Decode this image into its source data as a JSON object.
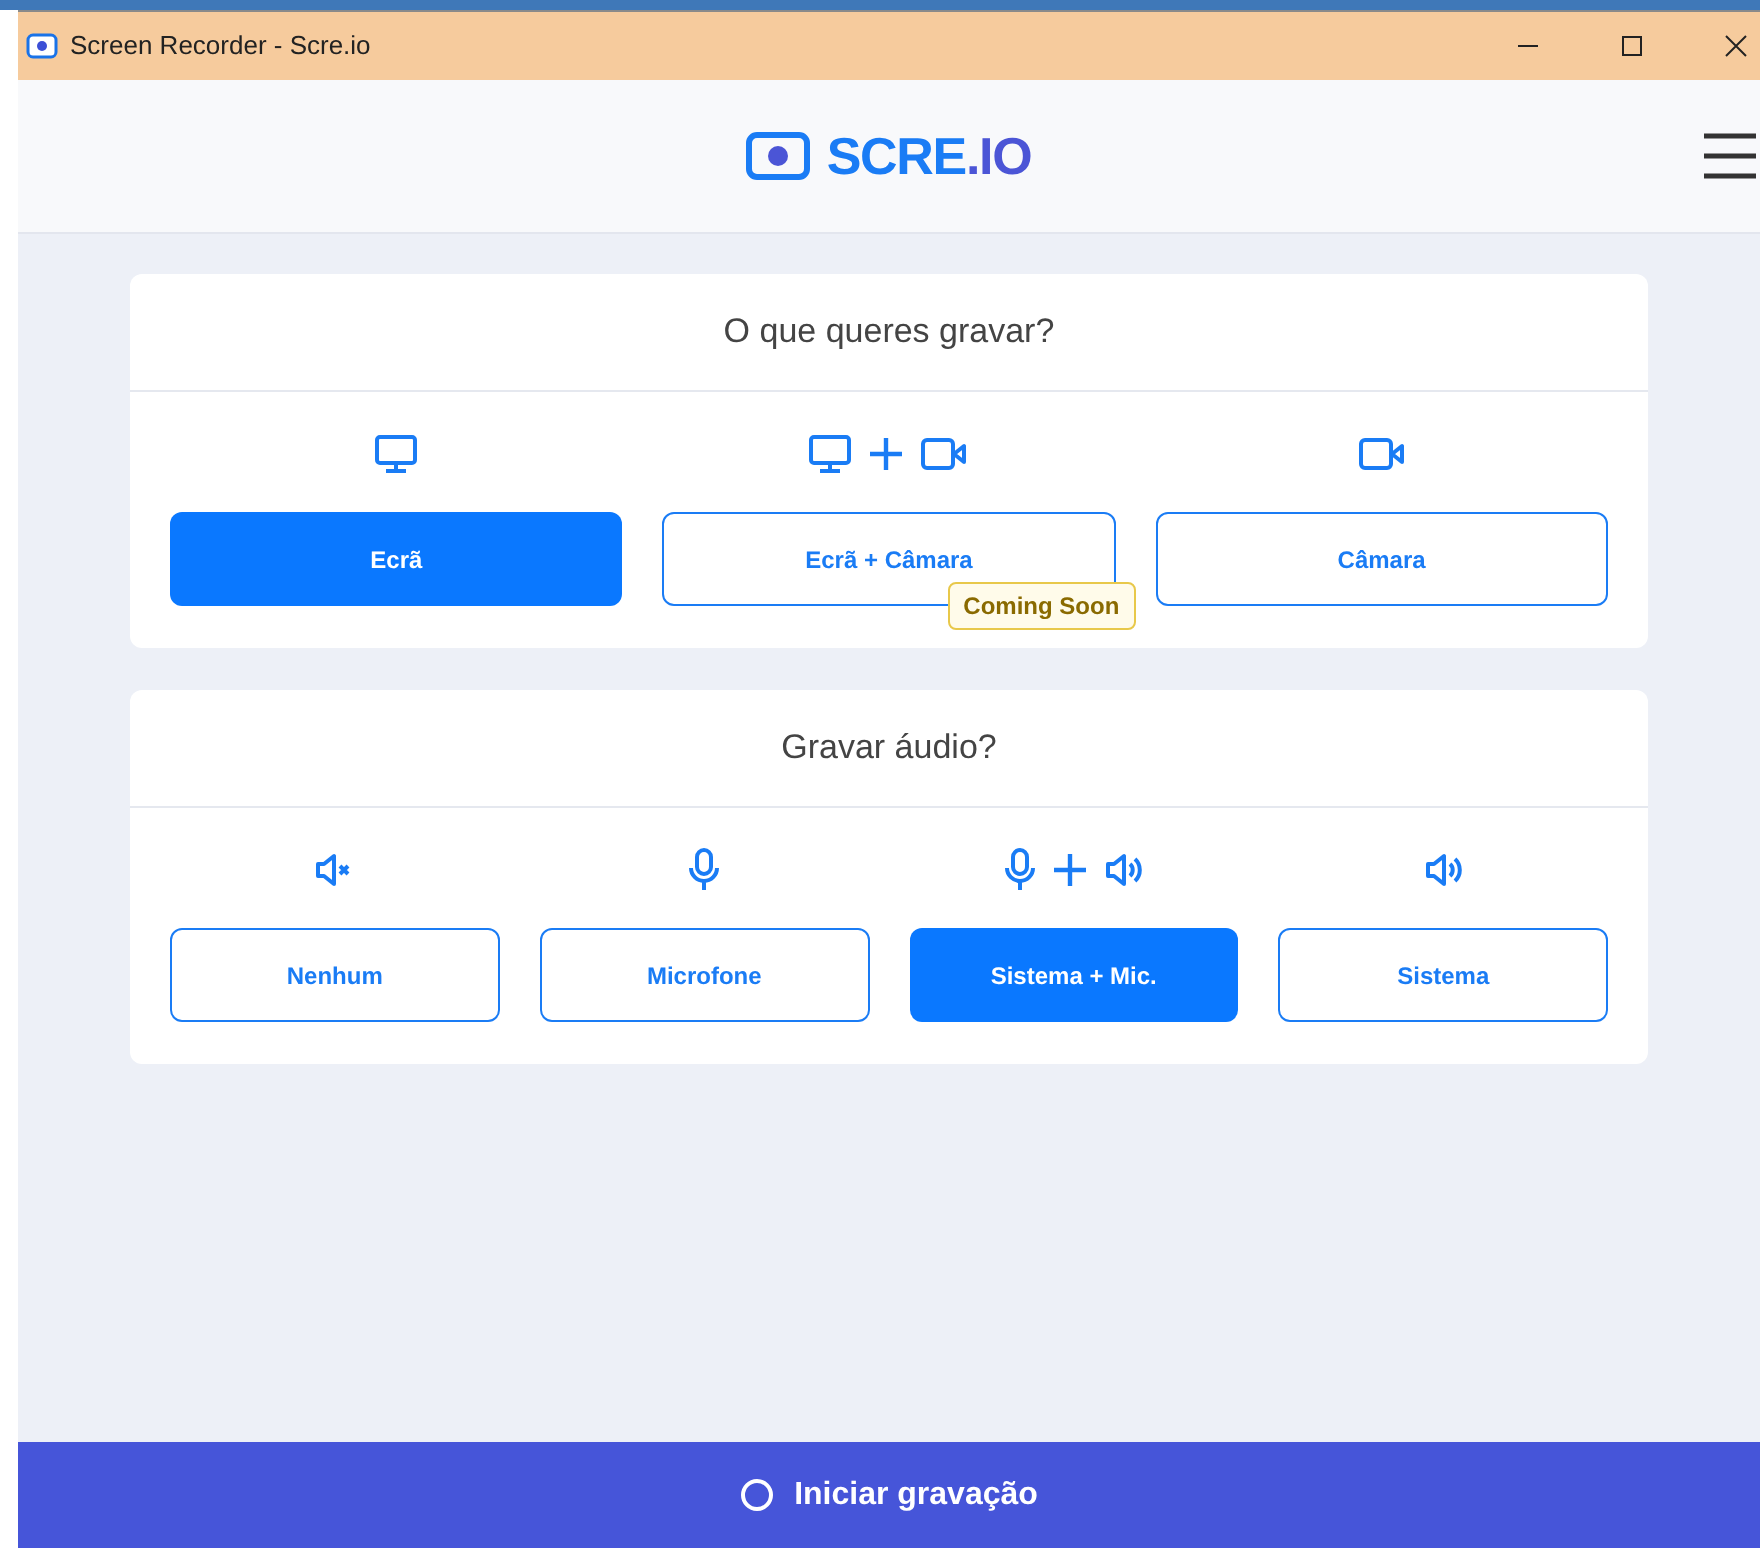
{
  "window": {
    "title": "Screen Recorder - Scre.io"
  },
  "header": {
    "logo_text": "SCRE",
    "logo_suffix": ".IO"
  },
  "sections": [
    {
      "title": "O que queres gravar?",
      "options": [
        {
          "kind": "screen",
          "label": "Ecrã",
          "selected": true
        },
        {
          "kind": "screen_camera",
          "label": "Ecrã + Câmara",
          "selected": false,
          "badge": "Coming Soon"
        },
        {
          "kind": "camera",
          "label": "Câmara",
          "selected": false
        }
      ]
    },
    {
      "title": "Gravar áudio?",
      "options": [
        {
          "kind": "muted",
          "label": "Nenhum",
          "selected": false
        },
        {
          "kind": "mic",
          "label": "Microfone",
          "selected": false
        },
        {
          "kind": "mic_system",
          "label": "Sistema + Mic.",
          "selected": true
        },
        {
          "kind": "system",
          "label": "Sistema",
          "selected": false
        }
      ]
    }
  ],
  "start_button": {
    "label": "Iniciar gravação"
  }
}
